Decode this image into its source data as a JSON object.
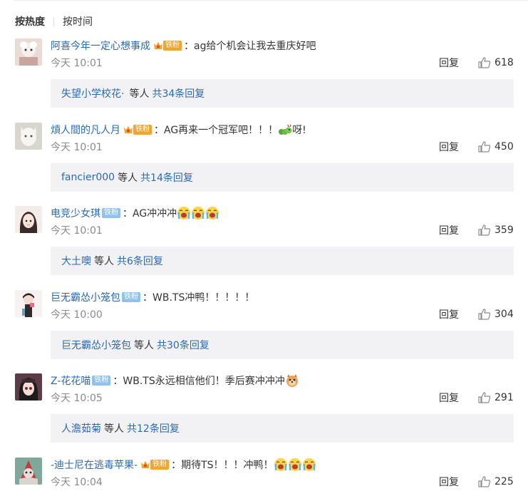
{
  "sort": {
    "hot": "按热度",
    "time": "按时间"
  },
  "comments": [
    {
      "user": "阿喜今年一定心想事成",
      "badge_type": "gold",
      "badge": "铁粉",
      "text": "ag给个机会让我去重庆好吧",
      "emojis": [],
      "time": "今天 10:01",
      "reply_label": "回复",
      "likes": "618",
      "sub_user": "失望小学校花·",
      "sub_middle": "等人",
      "sub_total": "共34条回复",
      "sub_badge": true
    },
    {
      "user": "熕人間的凡人月",
      "badge_type": "gold",
      "badge": "铁粉",
      "text": "AG再来一个冠军吧！！！",
      "text_after": "呀!",
      "emojis": [
        "caterpillar"
      ],
      "time": "今天 10:01",
      "reply_label": "回复",
      "likes": "450",
      "sub_user": "fancier000",
      "sub_middle": "等人",
      "sub_total": "共14条回复",
      "sub_badge": false
    },
    {
      "user": "电竞少女琪",
      "badge_type": "blue",
      "badge": "铁粉",
      "text": "AG冲冲冲",
      "emojis": [
        "cry",
        "cry",
        "cry"
      ],
      "time": "今天 10:01",
      "reply_label": "回复",
      "likes": "359",
      "sub_user": "大土噢",
      "sub_middle": "等人",
      "sub_total": "共6条回复",
      "sub_badge": false
    },
    {
      "user": "巨无霸怂小笼包",
      "badge_type": "blue",
      "badge": "铁粉",
      "text": "WB.TS冲鸭！！！！！",
      "emojis": [],
      "time": "今天 10:00",
      "reply_label": "回复",
      "likes": "304",
      "sub_user": "巨无霸怂小笼包",
      "sub_middle": "等人",
      "sub_total": "共30条回复",
      "sub_badge": false
    },
    {
      "user": "Z-花花喵",
      "badge_type": "blue",
      "badge": "铁粉",
      "text": "WB.TS永远相信他们！季后赛冲冲冲",
      "emojis": [
        "doge"
      ],
      "time": "今天 10:05",
      "reply_label": "回复",
      "likes": "291",
      "sub_user": "人澹茹菊",
      "sub_middle": "等人",
      "sub_total": "共12条回复",
      "sub_badge": false
    },
    {
      "user": "-迪士尼在逃毒苹果-",
      "badge_type": "gold",
      "badge": "铁粉",
      "text": "期待TS！！！冲鸭！",
      "emojis": [
        "cry",
        "cry",
        "cry"
      ],
      "time": "今天 10:04",
      "reply_label": "回复",
      "likes": "225",
      "sub_user": "",
      "sub_middle": "",
      "sub_total": "",
      "sub_badge": false
    }
  ],
  "colors": {
    "link": "#2a6ab3",
    "gold_badge": "#f2a52a",
    "blue_badge": "#8fc2ef",
    "reply_bg": "#f2f2f5"
  }
}
